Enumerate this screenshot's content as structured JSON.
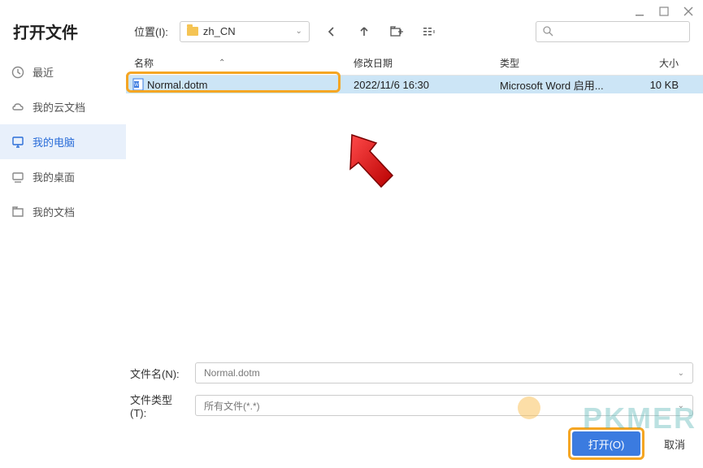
{
  "window": {
    "title": "打开文件",
    "location_label": "位置(I):",
    "location_value": "zh_CN"
  },
  "sidebar": {
    "items": [
      {
        "label": "最近",
        "icon": "clock-icon"
      },
      {
        "label": "我的云文档",
        "icon": "cloud-icon"
      },
      {
        "label": "我的电脑",
        "icon": "monitor-icon"
      },
      {
        "label": "我的桌面",
        "icon": "desktop-icon"
      },
      {
        "label": "我的文档",
        "icon": "folder-icon"
      }
    ]
  },
  "columns": {
    "name": "名称",
    "date": "修改日期",
    "type": "类型",
    "size": "大小"
  },
  "files": [
    {
      "name": "Normal.dotm",
      "date": "2022/11/6 16:30",
      "type": "Microsoft Word 启用...",
      "size": "10 KB"
    }
  ],
  "footer": {
    "filename_label": "文件名(N):",
    "filename_value": "Normal.dotm",
    "filetype_label": "文件类型(T):",
    "filetype_value": "所有文件(*.*)",
    "open_label": "打开(O)",
    "cancel_label": "取消"
  },
  "watermark": "PKMER"
}
